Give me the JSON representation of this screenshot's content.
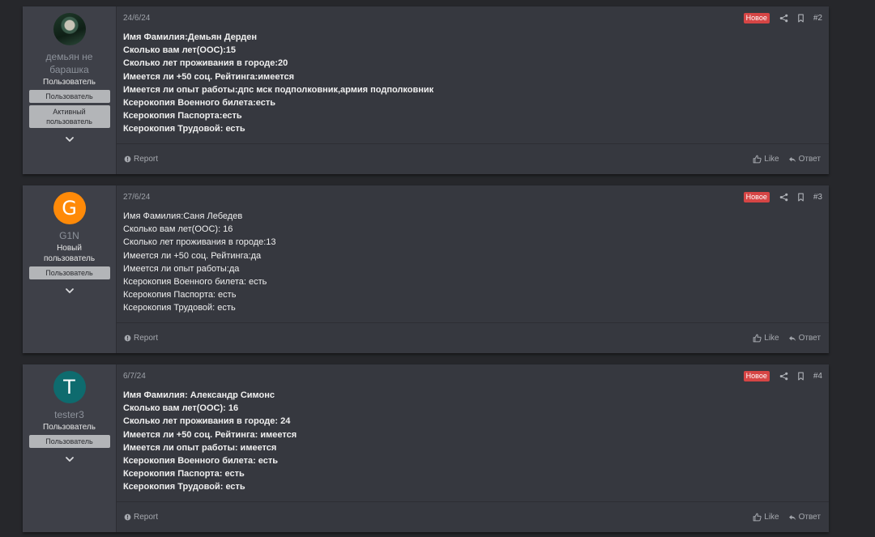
{
  "colors": {
    "page_bg": "#26272b",
    "post_bg": "#36383f",
    "user_col_bg": "#3e4048",
    "badge_new": "#d64545",
    "avatar_g": "#ff8a08",
    "avatar_t": "#0e6b6e"
  },
  "posts": [
    {
      "avatar_letter": "",
      "username": "демьян не барашка",
      "user_title": "Пользователь",
      "banners": [
        "Пользователь",
        "Активный пользователь"
      ],
      "date": "24/6/24",
      "new_badge": "Новое",
      "number": "#2",
      "lines": [
        "Имя Фамилия:Демьян Дерден",
        "Сколько вам лет(ООС):15",
        "Сколько лет проживания в городе:20",
        "Имеется ли +50 соц. Рейтинга:имеется",
        "Имеется ли опыт работы:дпс мск подполковник,армия подполковник",
        "Ксерокопия Военного билета:есть",
        "Ксерокопия Паспорта:есть",
        "Ксерокопия Трудовой: есть"
      ],
      "report_label": "Report",
      "like_label": "Like",
      "reply_label": "Ответ"
    },
    {
      "avatar_letter": "G",
      "username": "G1N",
      "user_title": "Новый пользователь",
      "banners": [
        "Пользователь"
      ],
      "date": "27/6/24",
      "new_badge": "Новое",
      "number": "#3",
      "lines": [
        "Имя Фамилия:Саня Лебедев",
        "Сколько вам лет(ООС): 16",
        "Сколько лет проживания в городе:13",
        "Имеется ли +50 соц. Рейтинга:да",
        "Имеется ли опыт работы:да",
        "Ксерокопия Военного билета: есть",
        "Ксерокопия Паспорта: есть",
        "Ксерокопия Трудовой: есть"
      ],
      "report_label": "Report",
      "like_label": "Like",
      "reply_label": "Ответ"
    },
    {
      "avatar_letter": "T",
      "username": "tester3",
      "user_title": "Пользователь",
      "banners": [
        "Пользователь"
      ],
      "date": "6/7/24",
      "new_badge": "Новое",
      "number": "#4",
      "lines": [
        "Имя Фамилия: Александр Симонс",
        "Сколько вам лет(ООС): 16",
        "Сколько лет проживания в городе: 24",
        "Имеется ли +50 соц. Рейтинга: имеется",
        "Имеется ли опыт работы: имеется",
        "Ксерокопия Военного билета: есть",
        "Ксерокопия Паспорта: есть",
        "Ксерокопия Трудовой: есть"
      ],
      "report_label": "Report",
      "like_label": "Like",
      "reply_label": "Ответ"
    }
  ]
}
